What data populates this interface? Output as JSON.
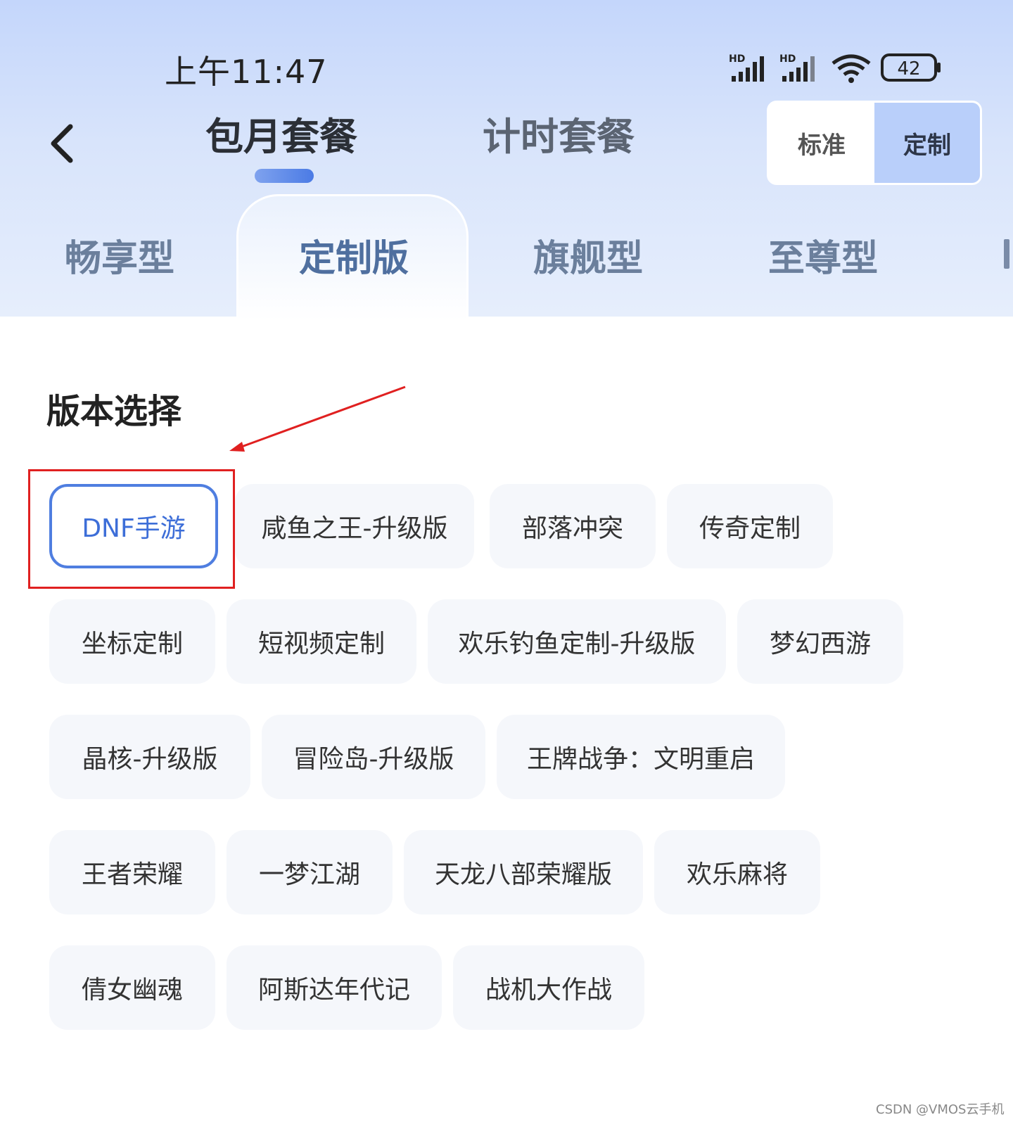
{
  "status_bar": {
    "time": "上午11:47",
    "battery": "42",
    "signal_label_1": "HD",
    "signal_label_2": "HD"
  },
  "header": {
    "tabs": [
      {
        "label": "包月套餐",
        "active": true
      },
      {
        "label": "计时套餐",
        "active": false
      }
    ],
    "toggle": {
      "standard": "标准",
      "custom": "定制",
      "selected": "定制"
    }
  },
  "type_tabs": [
    {
      "label": "畅享型"
    },
    {
      "label": "定制版",
      "active": true
    },
    {
      "label": "旗舰型"
    },
    {
      "label": "至尊型"
    }
  ],
  "section": {
    "title": "版本选择"
  },
  "versions": [
    {
      "label": "DNF手游",
      "selected": true
    },
    {
      "label": "咸鱼之王-升级版"
    },
    {
      "label": "部落冲突"
    },
    {
      "label": "传奇定制"
    },
    {
      "label": "坐标定制"
    },
    {
      "label": "短视频定制"
    },
    {
      "label": "欢乐钓鱼定制-升级版"
    },
    {
      "label": "梦幻西游"
    },
    {
      "label": "晶核-升级版"
    },
    {
      "label": "冒险岛-升级版"
    },
    {
      "label": "王牌战争：文明重启"
    },
    {
      "label": "王者荣耀"
    },
    {
      "label": "一梦江湖"
    },
    {
      "label": "天龙八部荣耀版"
    },
    {
      "label": "欢乐麻将"
    },
    {
      "label": "倩女幽魂"
    },
    {
      "label": "阿斯达年代记"
    },
    {
      "label": "战机大作战"
    }
  ],
  "colors": {
    "accent": "#4f7ee0",
    "annotation": "#e02020",
    "chip_bg": "#f5f7fb"
  },
  "watermark": "CSDN @VMOS云手机"
}
